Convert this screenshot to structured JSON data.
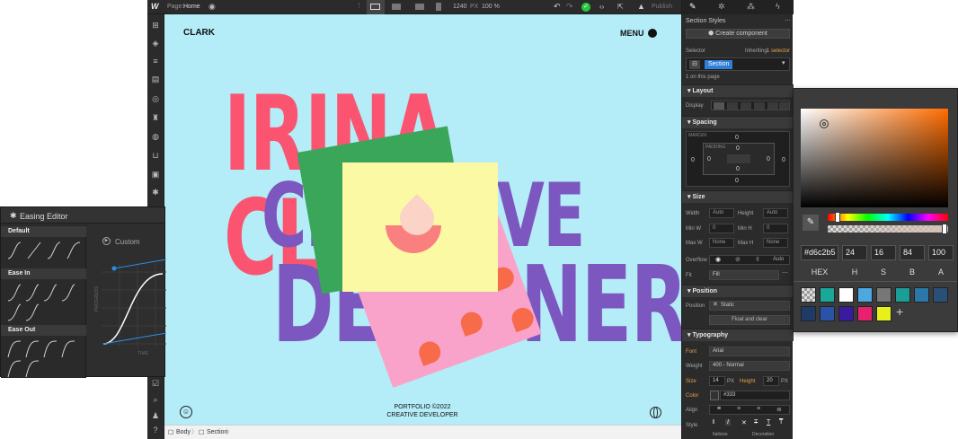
{
  "topbar": {
    "logo": "W",
    "page_label": "Page:",
    "page_name": "Home",
    "width_value": "1240",
    "width_unit": "PX",
    "zoom": "100 %",
    "publish_label": "Publish"
  },
  "canvas": {
    "brand": "CLARK",
    "menu_label": "MENU",
    "headline_line1": "IRINA CLARK.",
    "headline_line2": "CREATIVE",
    "headline_line3": "DESIGNER.",
    "footer_line1": "PORTFOLIO ©2022",
    "footer_line2": "CREATIVE DEVELOPER"
  },
  "breadcrumb": {
    "items": [
      "Body",
      "Section"
    ]
  },
  "easing": {
    "title": "Easing Editor",
    "groups": [
      "Default",
      "Ease In",
      "Ease Out"
    ],
    "custom_label": "Custom",
    "axis_y": "PROGRESS",
    "axis_x": "TIME"
  },
  "right_panel": {
    "header": "Section Styles",
    "create_component": "Create component",
    "selector_label": "Selector",
    "inheriting": "Inheriting",
    "inheriting_count": "1 selector",
    "selector_tag": "Section",
    "on_this_page": "1 on this page",
    "layout": {
      "title": "Layout",
      "display_label": "Display"
    },
    "spacing": {
      "title": "Spacing",
      "margin_label": "MARGIN",
      "padding_label": "PADDING",
      "values": [
        "0",
        "0",
        "0",
        "0",
        "0",
        "0",
        "0",
        "0"
      ]
    },
    "size": {
      "title": "Size",
      "width_label": "Width",
      "width_val": "Auto",
      "height_label": "Height",
      "height_val": "Auto",
      "minw_label": "Min W",
      "minw_val": "0",
      "minh_label": "Min H",
      "minh_val": "0",
      "maxw_label": "Max W",
      "maxw_val": "None",
      "maxh_label": "Max H",
      "maxh_val": "None",
      "unit": "PX",
      "overflow_label": "Overflow",
      "overflow_auto": "Auto",
      "fit_label": "Fit",
      "fit_val": "Fill"
    },
    "position": {
      "title": "Position",
      "label": "Position",
      "value": "Static",
      "float_clear": "Float and clear"
    },
    "typography": {
      "title": "Typography",
      "font_label": "Font",
      "font_val": "Arial",
      "weight_label": "Weight",
      "weight_val": "400 - Normal",
      "size_label": "Size",
      "size_val": "14",
      "size_unit": "PX",
      "height_label": "Height",
      "height_val": "20",
      "color_label": "Color",
      "color_val": "#333",
      "align_label": "Align",
      "style_label": "Style",
      "italicize": "Italicize",
      "decoration": "Decoration"
    }
  },
  "color_picker": {
    "hex": "#d6c2b5",
    "h": "24",
    "s": "16",
    "b": "84",
    "a": "100",
    "labels": [
      "HEX",
      "H",
      "S",
      "B",
      "A"
    ],
    "swatches": [
      "#1aa89a",
      "#ffffff",
      "#4da8e0",
      "#777777",
      "#1a9e96",
      "#2a77a8",
      "#2a4f78",
      "#1f3a66",
      "#2a52a8",
      "#3a1a9e",
      "#e8216e",
      "#e8f01a"
    ]
  }
}
